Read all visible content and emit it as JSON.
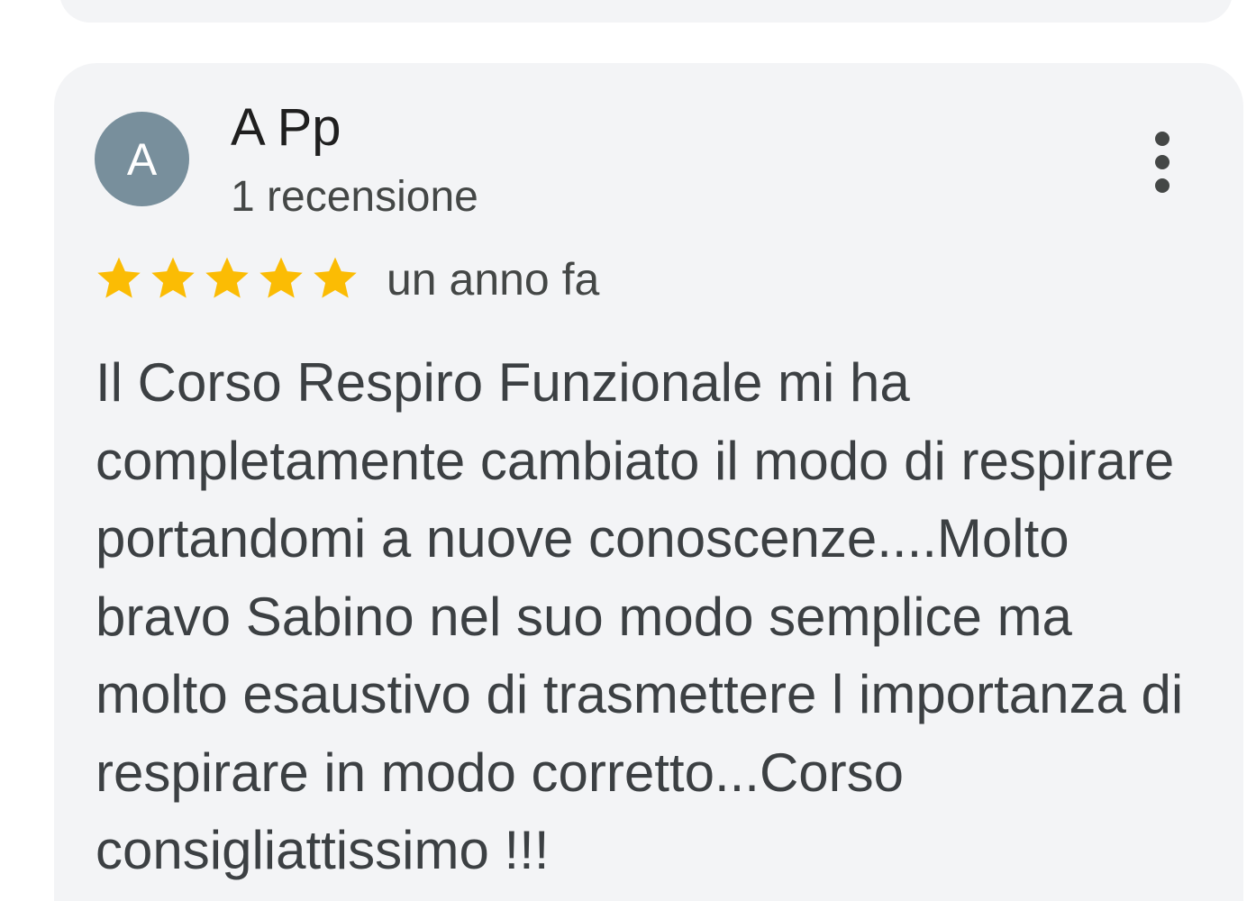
{
  "review": {
    "reviewer": {
      "initial": "A",
      "name": "A Pp",
      "review_count": "1 recensione",
      "avatar_color": "#788f9c"
    },
    "rating": {
      "value": 5,
      "max": 5,
      "star_color": "#fbbc04"
    },
    "time": "un anno fa",
    "text": "Il Corso Respiro Funzionale mi ha completamente cambiato il modo di respirare portandomi a nuove conoscenze....Molto bravo Sabino nel suo modo semplice ma molto esaustivo di trasmettere l importanza di respirare in modo corretto...Corso consigliattissimo !!!",
    "menu_icon": "more-vertical-icon"
  }
}
